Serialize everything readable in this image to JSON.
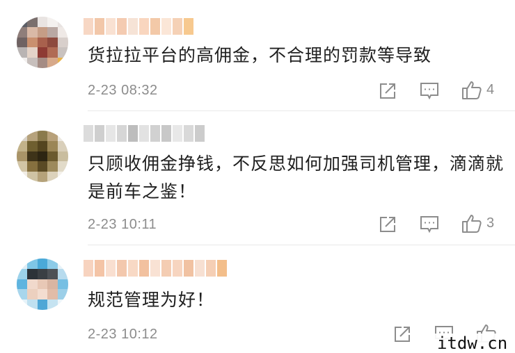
{
  "comments": [
    {
      "text": "货拉拉平台的高佣金，不合理的罚款等导致",
      "time": "2-23 08:32",
      "likes": "4",
      "avatar_colors": [
        "#5b5e66",
        "#7a6f6d",
        "#e9e4e2",
        "#f4f1ef",
        "#e8e3e1",
        "#8f7e7a",
        "#d9b9a6",
        "#c59d86",
        "#b9a8a3",
        "#efe9e6",
        "#6f6262",
        "#c9906f",
        "#a8614d",
        "#8d4a3e",
        "#d8cfcb",
        "#b9b4b3",
        "#e4d3c8",
        "#8e3b34",
        "#b06b54",
        "#c9c2bf",
        "#f2efee",
        "#c7bfbc",
        "#a58c84",
        "#d7a98a",
        "#e7b24c"
      ],
      "username_colors": [
        "#f7d7c4",
        "#f2c7a9",
        "#f9e1d2",
        "#f4cbb1",
        "#f6e3d6",
        "#f9d6bf",
        "#f3c9a8",
        "#fbe6d7",
        "#f5d1b6",
        "#f7c98f"
      ]
    },
    {
      "text": "只顾收佣金挣钱，不反思如何加强司机管理，滴滴就是前车之鉴！",
      "time": "2-23 10:11",
      "likes": "3",
      "avatar_colors": [
        "#d9d3c8",
        "#b6a27c",
        "#8a7a4c",
        "#b8a17a",
        "#ece8e1",
        "#c2b28a",
        "#6f5f30",
        "#54451f",
        "#9b8656",
        "#d9cfba",
        "#a99468",
        "#3e3319",
        "#2d2512",
        "#6b5a2e",
        "#c9bd9e",
        "#d2c5a6",
        "#86703f",
        "#5a4a24",
        "#9d8a5c",
        "#e2dbc9",
        "#f1ede6",
        "#cfc3a4",
        "#b5a27a",
        "#dcd2bb",
        "#f4f1eb"
      ],
      "username_colors": [
        "#dcdcdc",
        "#cfcfcf",
        "#e6e6e6",
        "#d6d6d6",
        "#bdbdbd",
        "#e2e2e2",
        "#d1d1d1",
        "#c8c8c8",
        "#e8e8e8",
        "#d9d9d9",
        "#cccccc"
      ]
    },
    {
      "text": "规范管理为好！",
      "time": "2-23 10:12",
      "likes": "",
      "avatar_colors": [
        "#dfeef6",
        "#7fc6e6",
        "#4aa9d8",
        "#8ccbe8",
        "#e6f2f8",
        "#9cd2ea",
        "#2c3238",
        "#3a3f44",
        "#4d5156",
        "#b7dbee",
        "#5fb4df",
        "#f1d9cc",
        "#e8c8b6",
        "#d9b5a2",
        "#76bfe3",
        "#a8d6ec",
        "#ecd0bf",
        "#f3ddd0",
        "#e1bca8",
        "#9ccfe8",
        "#e6f3f9",
        "#bfe0f0",
        "#4fa7d6",
        "#c5e3f1",
        "#eef6fa"
      ],
      "username_colors": [
        "#f7d3bf",
        "#f4c4a6",
        "#f9dfd0",
        "#f3c8ad",
        "#f8d9c5",
        "#f2c19f",
        "#f9e2d4",
        "#f4cdb3",
        "#f7d5c0",
        "#f1c2a2",
        "#f7e0d2",
        "#f5cfb5",
        "#f3be8a"
      ]
    }
  ],
  "icons": {
    "repost": "repost-icon",
    "comment": "comment-icon",
    "like": "like-icon"
  },
  "colors": {
    "text": "#1f1f1f",
    "meta": "#8c8c8c",
    "icon": "#8c8c8c",
    "divider": "#e8e8e8"
  },
  "watermark": "itdw.cn"
}
